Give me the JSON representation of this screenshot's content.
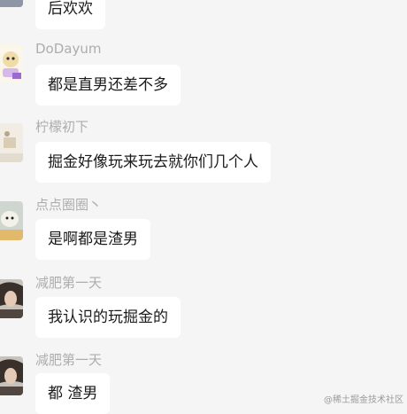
{
  "colors": {
    "background": "#f5f5f5",
    "bubble": "#ffffff",
    "sender_name": "#adadad",
    "message_text": "#1a1a1a"
  },
  "messages": [
    {
      "sender": "",
      "text": "后欢欢",
      "avatar": "partial-avatar"
    },
    {
      "sender": "DoDayum",
      "text": "都是直男还差不多",
      "avatar": "cartoon-character-avatar"
    },
    {
      "sender": "柠檬初下",
      "text": "掘金好像玩来玩去就你们几个人",
      "avatar": "light-photo-avatar"
    },
    {
      "sender": "点点圈圈丶",
      "text": "是啊都是渣男",
      "avatar": "dog-photo-avatar"
    },
    {
      "sender": "减肥第一天",
      "text": "我认识的玩掘金的",
      "avatar": "person-photo-avatar"
    },
    {
      "sender": "减肥第一天",
      "text": "都 渣男",
      "avatar": "person-photo-avatar"
    }
  ],
  "watermark": "@稀土掘金技术社区"
}
